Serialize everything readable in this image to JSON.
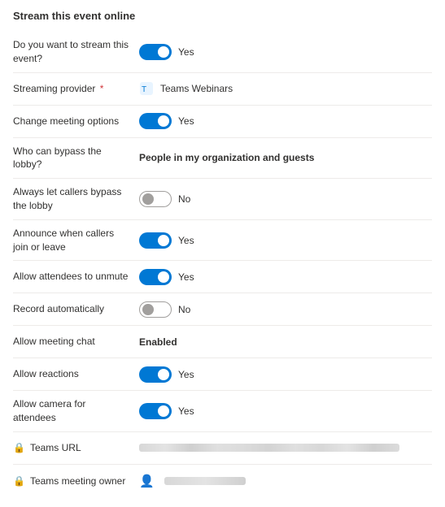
{
  "page": {
    "title": "Stream this event online"
  },
  "rows": [
    {
      "id": "stream-event",
      "label": "Do you want to stream this event?",
      "type": "toggle",
      "toggleOn": true,
      "value": "Yes"
    },
    {
      "id": "streaming-provider",
      "label": "Streaming provider",
      "required": true,
      "type": "provider",
      "value": "Teams Webinars"
    },
    {
      "id": "change-meeting-options",
      "label": "Change meeting options",
      "type": "toggle",
      "toggleOn": true,
      "value": "Yes"
    },
    {
      "id": "bypass-lobby",
      "label": "Who can bypass the lobby?",
      "type": "text-bold",
      "value": "People in my organization and guests"
    },
    {
      "id": "always-callers-bypass",
      "label": "Always let callers bypass the lobby",
      "type": "toggle",
      "toggleOn": false,
      "value": "No"
    },
    {
      "id": "announce-callers",
      "label": "Announce when callers join or leave",
      "type": "toggle",
      "toggleOn": true,
      "value": "Yes"
    },
    {
      "id": "allow-unmute",
      "label": "Allow attendees to unmute",
      "type": "toggle",
      "toggleOn": true,
      "value": "Yes"
    },
    {
      "id": "record-automatically",
      "label": "Record automatically",
      "type": "toggle",
      "toggleOn": false,
      "value": "No"
    },
    {
      "id": "meeting-chat",
      "label": "Allow meeting chat",
      "type": "text-bold",
      "value": "Enabled"
    },
    {
      "id": "allow-reactions",
      "label": "Allow reactions",
      "type": "toggle",
      "toggleOn": true,
      "value": "Yes"
    },
    {
      "id": "allow-camera",
      "label": "Allow camera for attendees",
      "type": "toggle",
      "toggleOn": true,
      "value": "Yes"
    },
    {
      "id": "teams-url",
      "label": "Teams URL",
      "type": "url",
      "value": ""
    },
    {
      "id": "teams-meeting-owner",
      "label": "Teams meeting owner",
      "type": "person",
      "value": ""
    }
  ],
  "labels": {
    "yes": "Yes",
    "no": "No",
    "enabled": "Enabled",
    "teams_webinars": "Teams Webinars",
    "bypass_lobby_value": "People in my organization and guests"
  }
}
